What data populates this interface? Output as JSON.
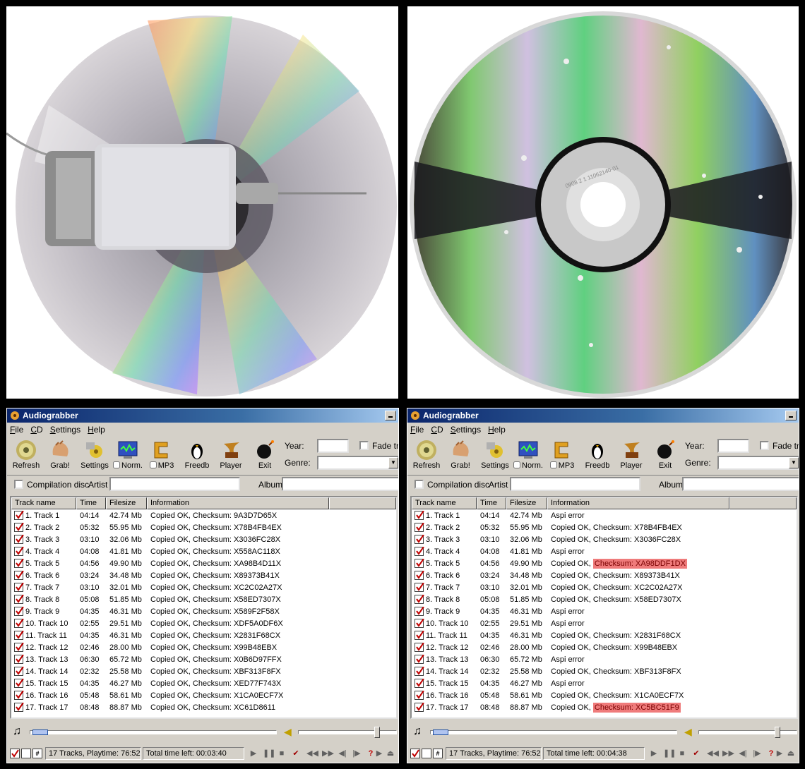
{
  "colors": {
    "title_bar": "#0a246a",
    "highlight": "#ef7b7b",
    "check_red": "#c00000",
    "face": "#d4d0c8"
  },
  "app": {
    "title": "Audiograbber",
    "menu": [
      "File",
      "CD",
      "Settings",
      "Help"
    ],
    "toolbar": {
      "refresh": "Refresh",
      "grab": "Grab!",
      "settings": "Settings",
      "norm": "Norm.",
      "mp3": "MP3",
      "freedb": "Freedb",
      "player": "Player",
      "exit": "Exit"
    },
    "year_label": "Year:",
    "genre_label": "Genre:",
    "fade_label": "Fade tra",
    "compilation_label": "Compilation disc",
    "artist_label": "Artist",
    "album_label": "Album",
    "columns": [
      "Track name",
      "Time",
      "Filesize",
      "Information"
    ]
  },
  "left_window": {
    "tracks": [
      {
        "name": "1. Track  1",
        "time": "04:14",
        "size": "42.74 Mb",
        "info": "Copied OK, Checksum: 9A3D7D65X"
      },
      {
        "name": "2. Track  2",
        "time": "05:32",
        "size": "55.95 Mb",
        "info": "Copied OK, Checksum: X78B4FB4EX"
      },
      {
        "name": "3. Track  3",
        "time": "03:10",
        "size": "32.06 Mb",
        "info": "Copied OK, Checksum: X3036FC28X"
      },
      {
        "name": "4. Track  4",
        "time": "04:08",
        "size": "41.81 Mb",
        "info": "Copied OK, Checksum: X558AC118X"
      },
      {
        "name": "5. Track  5",
        "time": "04:56",
        "size": "49.90 Mb",
        "info": "Copied OK, Checksum: XA98B4D11X"
      },
      {
        "name": "6. Track  6",
        "time": "03:24",
        "size": "34.48 Mb",
        "info": "Copied OK, Checksum: X89373B41X"
      },
      {
        "name": "7. Track  7",
        "time": "03:10",
        "size": "32.01 Mb",
        "info": "Copied OK, Checksum: XC2C02A27X"
      },
      {
        "name": "8. Track  8",
        "time": "05:08",
        "size": "51.85 Mb",
        "info": "Copied OK, Checksum: X58ED7307X"
      },
      {
        "name": "9. Track  9",
        "time": "04:35",
        "size": "46.31 Mb",
        "info": "Copied OK, Checksum: X589F2F58X"
      },
      {
        "name": "10. Track 10",
        "time": "02:55",
        "size": "29.51 Mb",
        "info": "Copied OK, Checksum: XDF5A0DF6X"
      },
      {
        "name": "11. Track 11",
        "time": "04:35",
        "size": "46.31 Mb",
        "info": "Copied OK, Checksum: X2831F68CX"
      },
      {
        "name": "12. Track 12",
        "time": "02:46",
        "size": "28.00 Mb",
        "info": "Copied OK, Checksum: X99B48EBX"
      },
      {
        "name": "13. Track 13",
        "time": "06:30",
        "size": "65.72 Mb",
        "info": "Copied OK, Checksum: X0B6D97FFX"
      },
      {
        "name": "14. Track 14",
        "time": "02:32",
        "size": "25.58 Mb",
        "info": "Copied OK, Checksum: XBF313F8FX"
      },
      {
        "name": "15. Track 15",
        "time": "04:35",
        "size": "46.27 Mb",
        "info": "Copied OK, Checksum: XED77F743X"
      },
      {
        "name": "16. Track 16",
        "time": "05:48",
        "size": "58.61 Mb",
        "info": "Copied OK, Checksum: X1CA0ECF7X"
      },
      {
        "name": "17. Track 17",
        "time": "08:48",
        "size": "88.87 Mb",
        "info": "Copied OK, Checksum: XC61D8611"
      }
    ],
    "status": {
      "tracks": "17 Tracks,  Playtime: 76:52",
      "time_left": "Total time left: 00:03:40"
    }
  },
  "right_window": {
    "tracks": [
      {
        "name": "1. Track  1",
        "time": "04:14",
        "size": "42.74 Mb",
        "info": "Aspi error"
      },
      {
        "name": "2. Track  2",
        "time": "05:32",
        "size": "55.95 Mb",
        "info": "Copied OK, Checksum: X78B4FB4EX"
      },
      {
        "name": "3. Track  3",
        "time": "03:10",
        "size": "32.06 Mb",
        "info": "Copied OK, Checksum: X3036FC28X"
      },
      {
        "name": "4. Track  4",
        "time": "04:08",
        "size": "41.81 Mb",
        "info": "Aspi error"
      },
      {
        "name": "5. Track  5",
        "time": "04:56",
        "size": "49.90 Mb",
        "info": "Copied OK, ",
        "hl": "Checksum: XA98DDF1DX"
      },
      {
        "name": "6. Track  6",
        "time": "03:24",
        "size": "34.48 Mb",
        "info": "Copied OK, Checksum: X89373B41X"
      },
      {
        "name": "7. Track  7",
        "time": "03:10",
        "size": "32.01 Mb",
        "info": "Copied OK, Checksum: XC2C02A27X"
      },
      {
        "name": "8. Track  8",
        "time": "05:08",
        "size": "51.85 Mb",
        "info": "Copied OK, Checksum: X58ED7307X"
      },
      {
        "name": "9. Track  9",
        "time": "04:35",
        "size": "46.31 Mb",
        "info": "Aspi error"
      },
      {
        "name": "10. Track 10",
        "time": "02:55",
        "size": "29.51 Mb",
        "info": "Aspi error"
      },
      {
        "name": "11. Track 11",
        "time": "04:35",
        "size": "46.31 Mb",
        "info": "Copied OK, Checksum: X2831F68CX"
      },
      {
        "name": "12. Track 12",
        "time": "02:46",
        "size": "28.00 Mb",
        "info": "Copied OK, Checksum: X99B48EBX"
      },
      {
        "name": "13. Track 13",
        "time": "06:30",
        "size": "65.72 Mb",
        "info": "Aspi error"
      },
      {
        "name": "14. Track 14",
        "time": "02:32",
        "size": "25.58 Mb",
        "info": "Copied OK, Checksum: XBF313F8FX"
      },
      {
        "name": "15. Track 15",
        "time": "04:35",
        "size": "46.27 Mb",
        "info": "Aspi error"
      },
      {
        "name": "16. Track 16",
        "time": "05:48",
        "size": "58.61 Mb",
        "info": "Copied OK, Checksum: X1CA0ECF7X"
      },
      {
        "name": "17. Track 17",
        "time": "08:48",
        "size": "88.87 Mb",
        "info": "Copied OK, ",
        "hl": "Checksum: XC5BC51F9"
      }
    ],
    "status": {
      "tracks": "17 Tracks,  Playtime: 76:52",
      "time_left": "Total time left: 00:04:38"
    }
  },
  "photos": {
    "left": "cd-with-motor-photo",
    "right": "scratched-cd-photo",
    "disc_print": "0908 2 1 11062140-01"
  }
}
